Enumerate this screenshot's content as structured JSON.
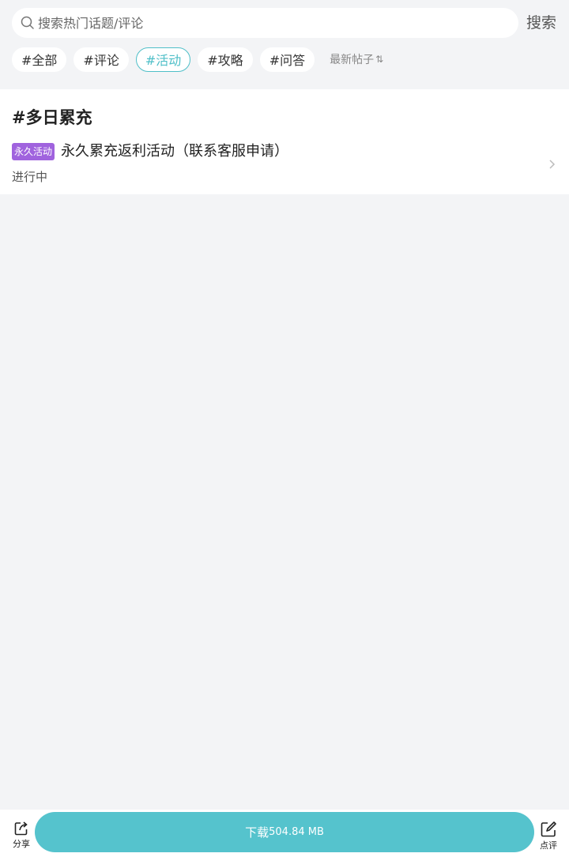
{
  "search": {
    "placeholder": "搜索热门话题/评论",
    "button_label": "搜索",
    "icon": "search-icon"
  },
  "chips": [
    {
      "label": "#全部",
      "active": false
    },
    {
      "label": "#评论",
      "active": false
    },
    {
      "label": "#活动",
      "active": true
    },
    {
      "label": "#攻略",
      "active": false
    },
    {
      "label": "#问答",
      "active": false
    }
  ],
  "sort": {
    "label": "最新帖子",
    "icon": "sort-arrows-icon"
  },
  "section": {
    "title": "#多日累充",
    "items": [
      {
        "badge": "永久活动",
        "title": "永久累充返利活动（联系客服申请）",
        "status": "进行中"
      }
    ]
  },
  "bottom_bar": {
    "share_label": "分享",
    "download_label": "下载",
    "download_size": "504.84 MB",
    "review_label": "点评"
  },
  "colors": {
    "accent": "#55c3cd",
    "chip_active": "#4fbfc8",
    "badge": "#a063de",
    "background": "#f3f4f6"
  }
}
